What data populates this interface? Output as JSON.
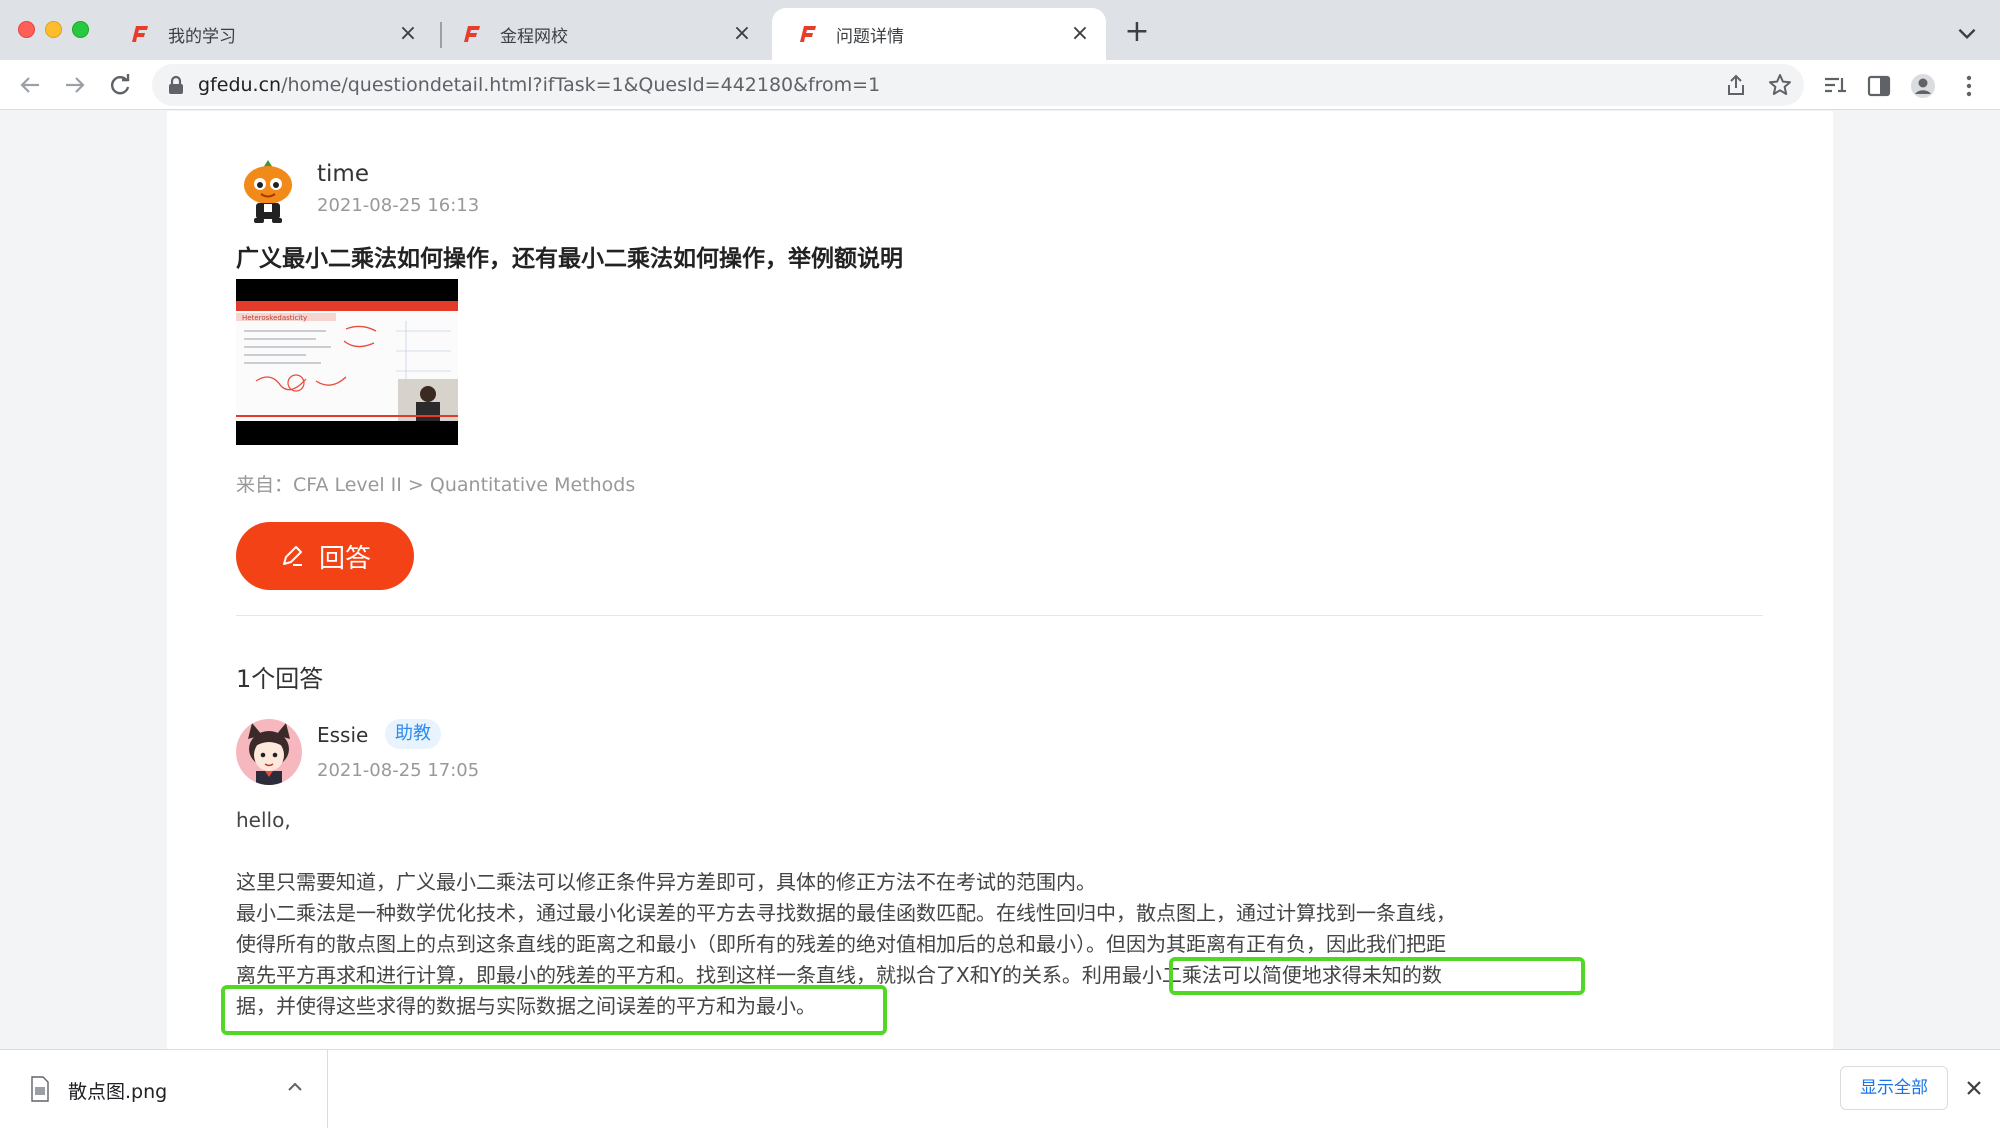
{
  "browser": {
    "tabs": [
      {
        "title": "我的学习",
        "favicon": "gfedu-logo-icon"
      },
      {
        "title": "金程网校",
        "favicon": "gfedu-logo-icon"
      },
      {
        "title": "问题详情",
        "favicon": "gfedu-logo-icon",
        "active": true
      }
    ],
    "url_host": "gfedu.cn",
    "url_path": "/home/questiondetail.html?ifTask=1&QuesId=442180&from=1"
  },
  "question": {
    "username": "time",
    "date": "2021-08-25 16:13",
    "title": "广义最小二乘法如何操作，还有最小二乘法如何操作，举例额说明",
    "source": "来自：CFA Level II > Quantitative Methods",
    "thumbnail_text": "Heteroskedasticity"
  },
  "answer_button": {
    "label": "回答"
  },
  "answers": {
    "count_label": "1个回答",
    "items": [
      {
        "username": "Essie",
        "badge": "助教",
        "date": "2021-08-25 17:05",
        "greeting": "hello,",
        "para1": "这里只需要知道，广义最小二乘法可以修正条件异方差即可，具体的修正方法不在考试的范围内。",
        "para2_line1": "最小二乘法是一种数学优化技术，通过最小化误差的平方去寻找数据的最佳函数匹配。在线性回归中，散点图上，通过计算找到一条直线，",
        "para2_line2": "使得所有的散点图上的点到这条直线的距离之和最小（即所有的残差的绝对值相加后的总和最小）。但因为其距离有正有负，因此我们把距",
        "para2_line3a": "离先平方再求和进行计算，即最小的残差的平方和。找到这样一条直线，就拟合了X和Y的关系。",
        "para2_line3b": "利用最小二乘法可以简便地求得未知的数",
        "para2_line4": "据，并使得这些求得的数据与实际数据之间误差的平方和为最小。"
      }
    ]
  },
  "downloads": {
    "file_name": "散点图.png",
    "show_all": "显示全部"
  },
  "colors": {
    "accent": "#f34216",
    "badge_bg": "#e8f3fe",
    "badge_text": "#2d8cf0",
    "highlight": "#52d726"
  }
}
